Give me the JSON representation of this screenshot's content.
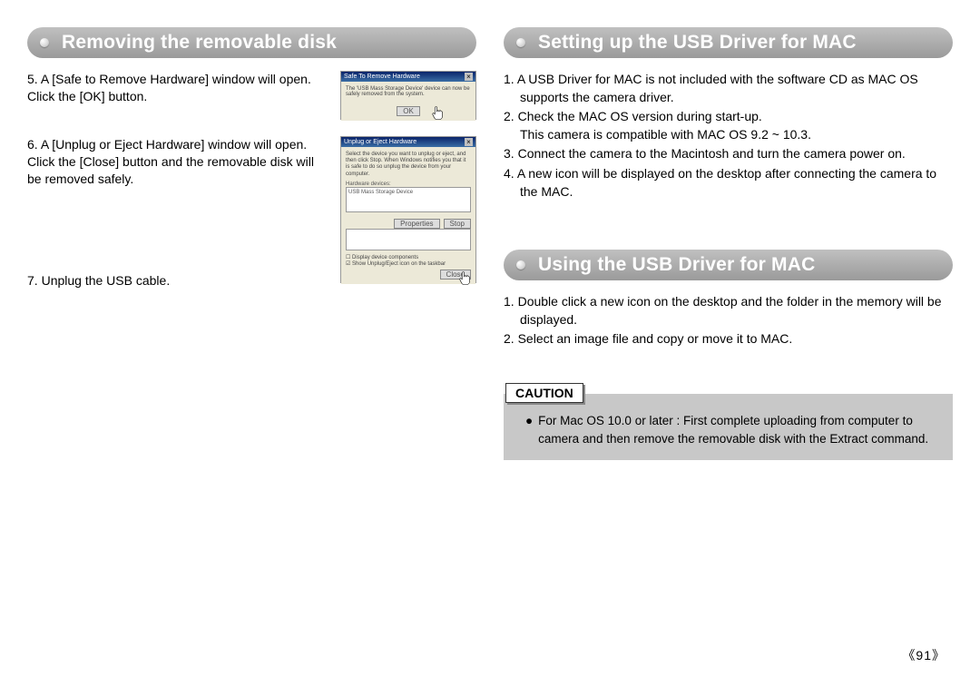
{
  "left": {
    "heading": "Removing the removable disk",
    "items": [
      {
        "num": "5.",
        "text": "A [Safe to Remove Hardware] window will open. Click the [OK] button."
      },
      {
        "num": "6.",
        "text": "A [Unplug or Eject Hardware] window will open. Click the [Close] button and the removable disk will be removed safely."
      },
      {
        "num": "7.",
        "text": "Unplug the USB cable."
      }
    ],
    "thumb1": {
      "title": "Safe To Remove Hardware",
      "msg": "The 'USB Mass Storage Device' device can now be safely removed from the system.",
      "ok": "OK"
    },
    "thumb2": {
      "title": "Unplug or Eject Hardware",
      "desc": "Select the device you want to unplug or eject, and then click Stop. When Windows notifies you that it is safe to do so unplug the device from your computer.",
      "row": "USB Mass Storage Device",
      "label": "Hardware devices:",
      "chk1": "Display device components",
      "chk2": "Show Unplug/Eject icon on the taskbar",
      "stop": "Stop",
      "close": "Close",
      "props": "Properties"
    }
  },
  "right_a": {
    "heading": "Setting up the USB Driver for MAC",
    "items": [
      {
        "num": "1.",
        "text": "A USB Driver for MAC is not included with the software CD as MAC OS supports the camera driver."
      },
      {
        "num": "2.",
        "text": "Check the MAC OS version during start-up.",
        "sub": "This camera is compatible with MAC OS 9.2 ~ 10.3."
      },
      {
        "num": "3.",
        "text": "Connect the camera to the Macintosh and turn the camera power on."
      },
      {
        "num": "4.",
        "text": "A new icon will be displayed on the desktop after connecting the camera to the MAC."
      }
    ]
  },
  "right_b": {
    "heading": "Using the USB Driver for MAC",
    "items": [
      {
        "num": "1.",
        "text": "Double click a new icon on the desktop and the folder in the memory will be displayed."
      },
      {
        "num": "2.",
        "text": "Select an image file and copy or move it to MAC."
      }
    ]
  },
  "caution": {
    "label": "CAUTION",
    "bullet": "●",
    "text": "For Mac OS 10.0 or later : First complete uploading from computer to camera and then remove the removable disk with the Extract command."
  },
  "page": "《91》"
}
